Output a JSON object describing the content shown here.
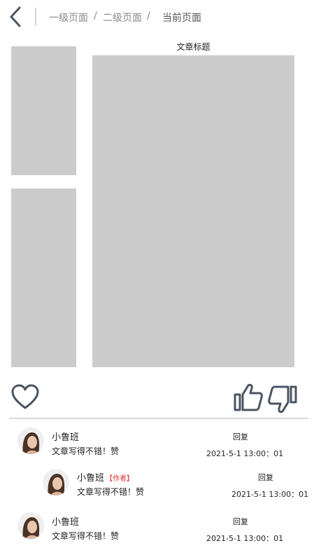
{
  "breadcrumb": {
    "items": [
      "一级页面",
      "二级页面",
      "当前页面"
    ],
    "separator": "/"
  },
  "article": {
    "title": "文章标题"
  },
  "colors": {
    "placeholder": "#cccccc",
    "icon": "#4a5463",
    "author_badge": "#e03030"
  },
  "icons": {
    "back": "chevron-left-icon",
    "like": "heart-icon",
    "upvote": "thumbs-up-icon",
    "downvote": "thumbs-down-icon"
  },
  "comments": [
    {
      "name": "小鲁班",
      "text": "文章写得不错！赞",
      "reply": "回复",
      "time": "2021-5-1 13:00：01",
      "badge": ""
    },
    {
      "name": "小鲁班",
      "text": "文章写得不错！赞",
      "reply": "回复",
      "time": "2021-5-1 13:00：01",
      "badge": "【作者】"
    },
    {
      "name": "小鲁班",
      "text": "文章写得不错！赞",
      "reply": "回复",
      "time": "2021-5-1 13:00：01",
      "badge": ""
    }
  ]
}
